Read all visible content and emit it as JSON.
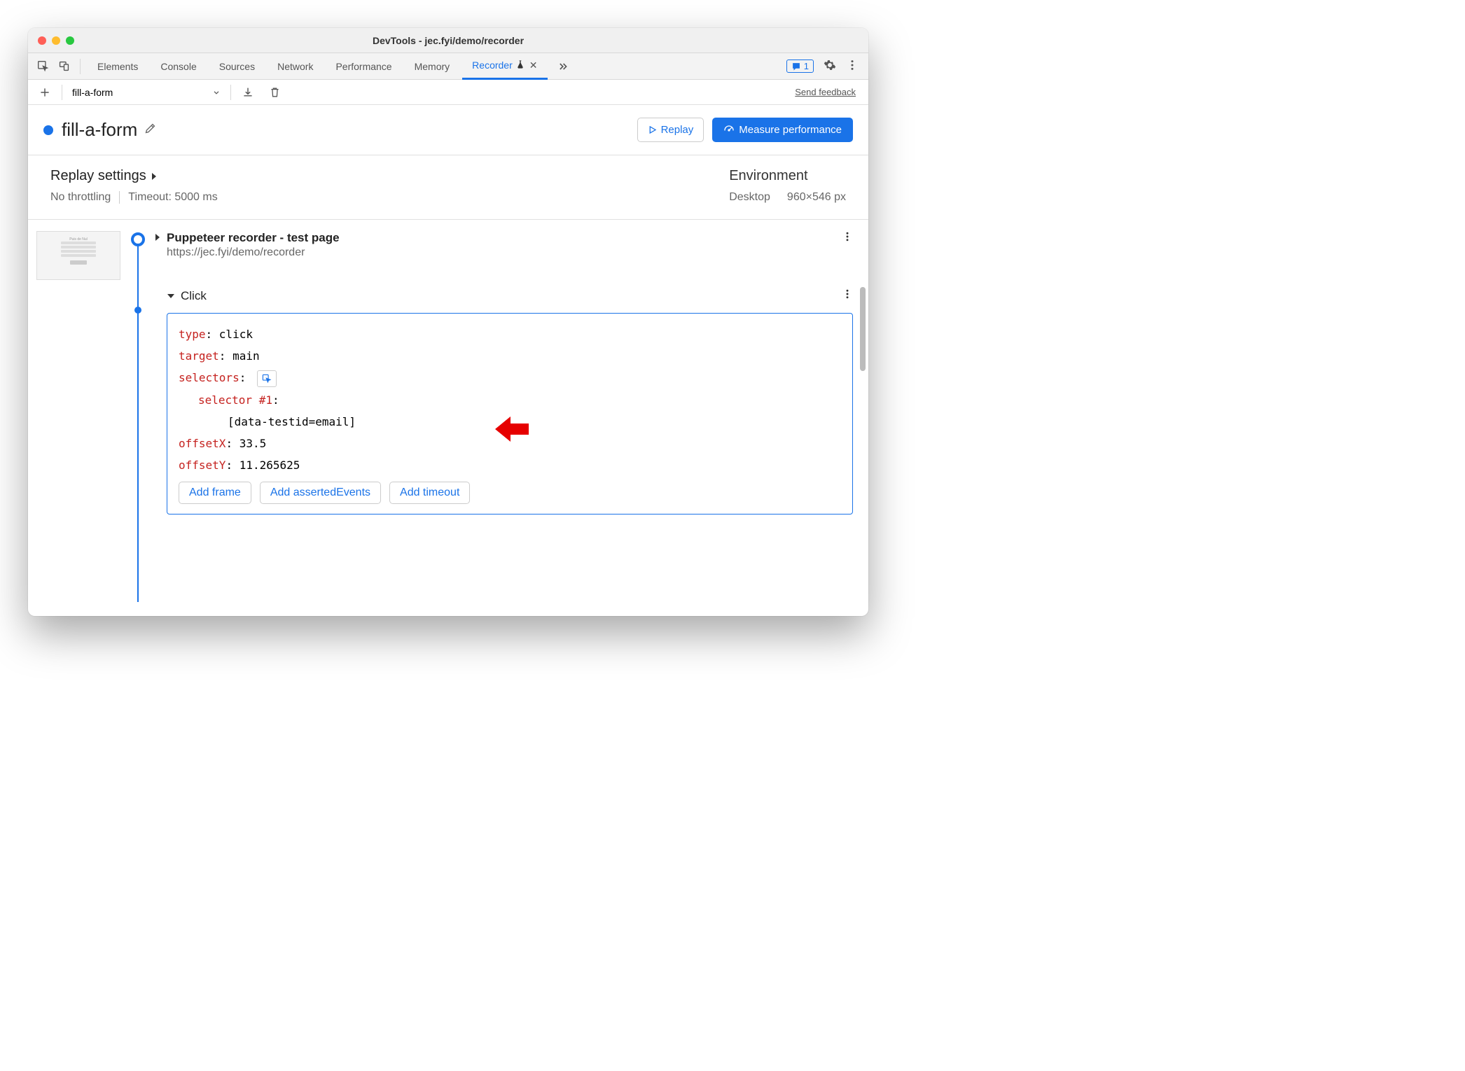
{
  "window": {
    "title": "DevTools - jec.fyi/demo/recorder"
  },
  "tabs": {
    "items": [
      "Elements",
      "Console",
      "Sources",
      "Network",
      "Performance",
      "Memory"
    ],
    "active": "Recorder",
    "issues_count": "1"
  },
  "toolbar": {
    "recording_name": "fill-a-form",
    "feedback": "Send feedback"
  },
  "header": {
    "recording_title": "fill-a-form",
    "replay": "Replay",
    "measure": "Measure performance"
  },
  "settings": {
    "replay_label": "Replay settings",
    "throttling": "No throttling",
    "timeout": "Timeout: 5000 ms",
    "env_label": "Environment",
    "device": "Desktop",
    "dimensions": "960×546 px"
  },
  "steps": {
    "initial": {
      "title": "Puppeteer recorder - test page",
      "url": "https://jec.fyi/demo/recorder"
    },
    "click": {
      "label": "Click",
      "details": {
        "k_type": "type",
        "v_type": "click",
        "k_target": "target",
        "v_target": "main",
        "k_selectors": "selectors",
        "k_selector1": "selector #1",
        "v_selector1": "[data-testid=email]",
        "k_offsetX": "offsetX",
        "v_offsetX": "33.5",
        "k_offsetY": "offsetY",
        "v_offsetY": "11.265625"
      },
      "add_frame": "Add frame",
      "add_asserted": "Add assertedEvents",
      "add_timeout": "Add timeout"
    }
  }
}
